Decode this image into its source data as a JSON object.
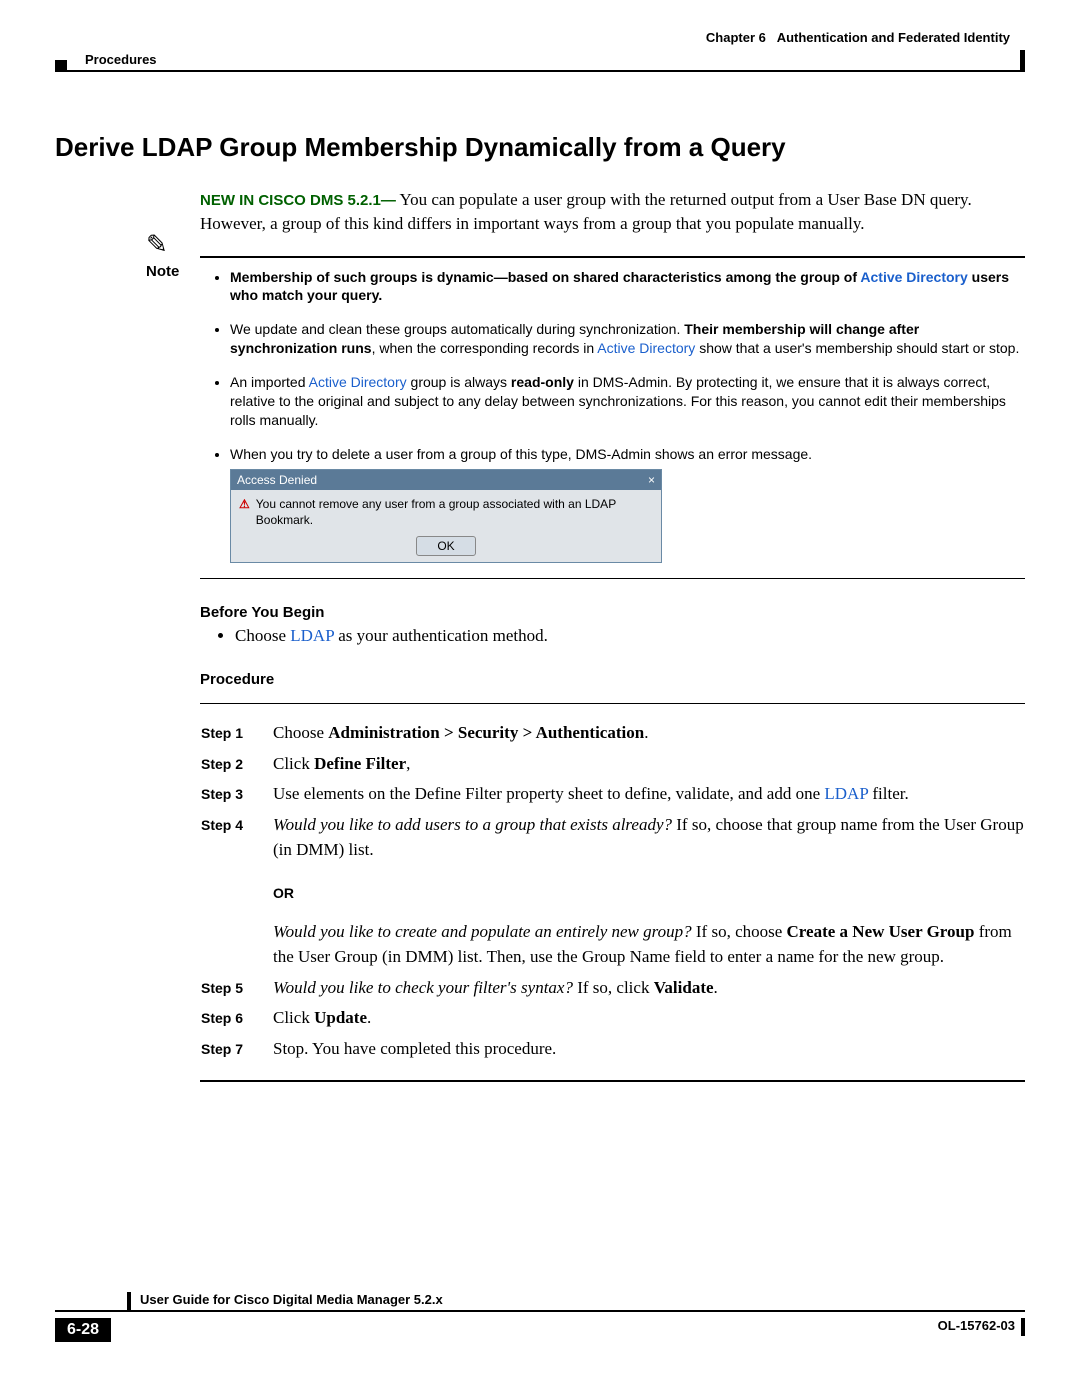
{
  "header": {
    "chapter": "Chapter 6   Authentication and Federated Identity",
    "procedures": "Procedures"
  },
  "section_title": "Derive LDAP Group Membership Dynamically from a Query",
  "intro": {
    "new_tag": "NEW IN CISCO DMS 5.2.1—",
    "text": "You can populate a user group with the returned output from a User Base DN query. However, a group of this kind differs in important ways from a group that you populate manually."
  },
  "note": {
    "label": "Note",
    "items": [
      {
        "pre_bold": "Membership of such groups is dynamic—based on shared characteristics among the group of ",
        "link": "Active Directory",
        "post_bold_strong": " users who match your query."
      },
      {
        "text_a": "We update and clean these groups automatically during synchronization. ",
        "bold_a": "Their membership will change after synchronization runs",
        "text_b": ", when the corresponding records in ",
        "link": "Active Directory",
        "text_c": " show that a user's membership should start or stop."
      },
      {
        "text_a": "An imported ",
        "link": "Active Directory",
        "text_b": " group is always ",
        "bold": "read-only",
        "text_c": " in DMS-Admin. By protecting it, we ensure that it is always correct, relative to the original and subject to any delay between synchronizations. For this reason, you cannot edit their memberships rolls manually."
      },
      {
        "plain": "When you try to delete a user from a group of this type, DMS-Admin shows an error message."
      }
    ]
  },
  "dialog": {
    "title": "Access Denied",
    "close": "×",
    "warn": "⚠",
    "msg": "You cannot remove any user from a group associated with an LDAP Bookmark.",
    "ok": "OK"
  },
  "byb": {
    "heading": "Before You Begin",
    "item_pre": "Choose ",
    "link": "LDAP",
    "item_post": " as your authentication method."
  },
  "procedure_heading": "Procedure",
  "steps": [
    {
      "label": "Step 1",
      "html": "Choose <b>Administration > Security > Authentication</b>."
    },
    {
      "label": "Step 2",
      "html": "Click <b>Define Filter</b>,"
    },
    {
      "label": "Step 3",
      "html": "Use elements on the Define Filter property sheet to define, validate, and add one <span class='link'>LDAP</span> filter."
    },
    {
      "label": "Step 4",
      "html": "<em>Would you like to add users to a group that exists already?</em> If so, choose that group name from the User Group (in DMM) list."
    }
  ],
  "or_label": "OR",
  "step4_extra": "<em>Would you like to create and populate an entirely new group?</em> If so, choose <b>Create a New User Group</b> from the User Group (in DMM) list. Then, use the Group Name field to enter a name for the new group.",
  "steps_b": [
    {
      "label": "Step 5",
      "html": "<em>Would you like to check your filter's syntax?</em> If so, click <b>Validate</b>."
    },
    {
      "label": "Step 6",
      "html": "Click <b>Update</b>."
    },
    {
      "label": "Step 7",
      "html": "Stop. You have completed this procedure."
    }
  ],
  "footer": {
    "guide": "User Guide for Cisco Digital Media Manager 5.2.x",
    "page": "6-28",
    "ol": "OL-15762-03"
  }
}
